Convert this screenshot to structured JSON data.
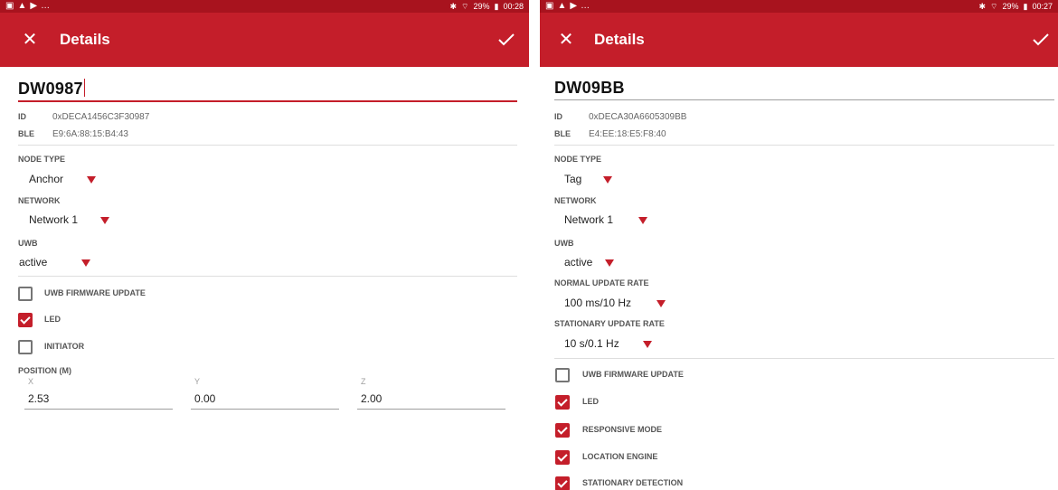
{
  "left": {
    "status": {
      "bluetooth": "✱",
      "wifi": "⌔",
      "battery": "29%",
      "time": "00:28",
      "more": "…"
    },
    "appbar": {
      "title": "Details"
    },
    "node": {
      "name": "DW0987"
    },
    "info": {
      "id_label": "ID",
      "id_value": "0xDECA1456C3F30987",
      "ble_label": "BLE",
      "ble_value": "E9:6A:88:15:B4:43"
    },
    "node_type": {
      "label": "NODE TYPE",
      "value": "Anchor"
    },
    "network": {
      "label": "NETWORK",
      "value": "Network 1"
    },
    "uwb": {
      "label": "UWB",
      "value": "active"
    },
    "checkboxes": [
      {
        "label": "UWB FIRMWARE UPDATE",
        "checked": false
      },
      {
        "label": "LED",
        "checked": true
      },
      {
        "label": "INITIATOR",
        "checked": false
      }
    ],
    "position": {
      "label": "POSITION (M)",
      "x_label": "X",
      "x_value": "2.53",
      "y_label": "Y",
      "y_value": "0.00",
      "z_label": "Z",
      "z_value": "2.00"
    }
  },
  "right": {
    "status": {
      "bluetooth": "✱",
      "wifi": "⌔",
      "battery": "29%",
      "time": "00:27",
      "more": "…"
    },
    "appbar": {
      "title": "Details"
    },
    "node": {
      "name": "DW09BB"
    },
    "info": {
      "id_label": "ID",
      "id_value": "0xDECA30A6605309BB",
      "ble_label": "BLE",
      "ble_value": "E4:EE:18:E5:F8:40"
    },
    "node_type": {
      "label": "NODE TYPE",
      "value": "Tag"
    },
    "network": {
      "label": "NETWORK",
      "value": "Network 1"
    },
    "uwb": {
      "label": "UWB",
      "value": "active"
    },
    "normal_rate": {
      "label": "NORMAL UPDATE RATE",
      "value": "100 ms/10 Hz"
    },
    "stationary_rate": {
      "label": "STATIONARY UPDATE RATE",
      "value": "10 s/0.1 Hz"
    },
    "checkboxes": [
      {
        "label": "UWB FIRMWARE UPDATE",
        "checked": false
      },
      {
        "label": "LED",
        "checked": true
      },
      {
        "label": "RESPONSIVE MODE",
        "checked": true
      },
      {
        "label": "LOCATION ENGINE",
        "checked": true
      },
      {
        "label": "STATIONARY DETECTION",
        "checked": true
      }
    ]
  },
  "colors": {
    "appbar": "#c41e2a",
    "statusbar": "#a8131e",
    "accent": "#c41e2a"
  },
  "icons": {
    "close": "close-icon",
    "confirm": "check-icon",
    "dropdown": "triangle-down-icon"
  }
}
